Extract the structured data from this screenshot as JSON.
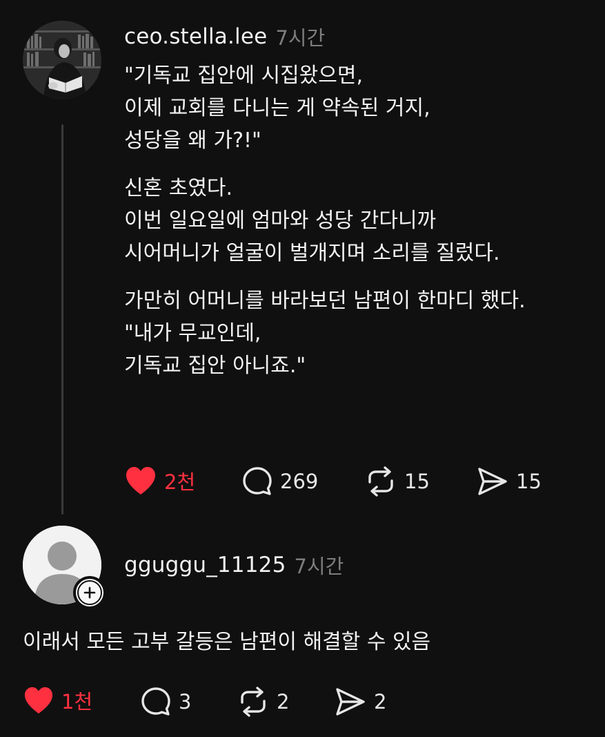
{
  "post": {
    "username": "ceo.stella.lee",
    "time": "7시간",
    "paragraphs": [
      [
        "\"기독교 집안에 시집왔으면,",
        "이제 교회를 다니는 게 약속된 거지,",
        "성당을 왜 가?!\""
      ],
      [
        "신혼 초였다.",
        "이번 일요일에 엄마와 성당 간다니까",
        "시어머니가 얼굴이 벌개지며 소리를 질렀다."
      ],
      [
        "가만히 어머니를 바라보던 남편이 한마디 했다.",
        "\"내가 무교인데,",
        "기독교 집안 아니죠.\""
      ]
    ],
    "actions": {
      "likes": "2천",
      "comments": "269",
      "reposts": "15",
      "shares": "15"
    }
  },
  "reply": {
    "username": "gguggu_11125",
    "time": "7시간",
    "text": "이래서 모든 고부 갈등은 남편이 해결할 수 있음",
    "actions": {
      "likes": "1천",
      "comments": "3",
      "reposts": "2",
      "shares": "2"
    }
  },
  "colors": {
    "background": "#101010",
    "like_red": "#ff3040",
    "muted_gray": "#7d7d7d",
    "thread_line": "#3a3a3a"
  },
  "icons": {
    "like": "heart-icon",
    "comment": "comment-bubble-icon",
    "repost": "repost-icon",
    "share": "send-icon",
    "follow": "plus-icon"
  }
}
